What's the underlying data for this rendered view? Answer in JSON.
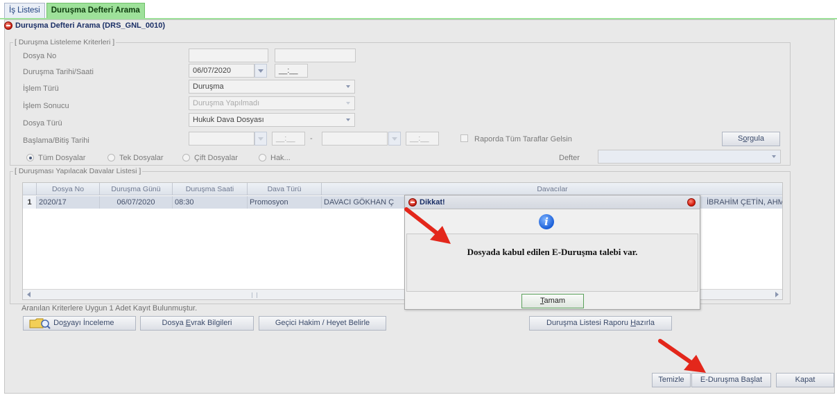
{
  "tabs": [
    {
      "label": "İş Listesi",
      "active": false
    },
    {
      "label": "Duruşma Defteri Arama",
      "active": true
    }
  ],
  "window_title": "Duruşma Defteri Arama (DRS_GNL_0010)",
  "criteria": {
    "legend": "[ Duruşma Listeleme Kriterleri ]",
    "dosya_no_label": "Dosya No",
    "durusma_tarihi_label": "Duruşma Tarihi/Saati",
    "durusma_tarihi_value": "06/07/2020",
    "durusma_saat_value": "__:__",
    "islem_turu_label": "İşlem Türü",
    "islem_turu_value": "Duruşma",
    "islem_sonucu_label": "İşlem Sonucu",
    "islem_sonucu_value": "Duruşma Yapılmadı",
    "dosya_turu_label": "Dosya Türü",
    "dosya_turu_value": "Hukuk Dava Dosyası",
    "baslama_label": "Başlama/Bitiş Tarihi",
    "baslama_saat": "__:__",
    "bitis_saat": "__:__",
    "dash": "-",
    "raporda_label": "Raporda Tüm Taraflar Gelsin",
    "sorgula_prefix": "S",
    "sorgula_underlined": "o",
    "sorgula_suffix": "rgula",
    "radios": [
      {
        "label": "Tüm Dosyalar",
        "selected": true
      },
      {
        "label": "Tek Dosyalar",
        "selected": false
      },
      {
        "label": "Çift Dosyalar",
        "selected": false
      },
      {
        "label": "Hak...",
        "selected": false
      }
    ],
    "defter_label": "Defter"
  },
  "list": {
    "legend": "[ Duruşması Yapılacak Davalar Listesi ]",
    "columns": [
      "Dosya No",
      "Duruşma Günü",
      "Duruşma Saati",
      "Dava Türü",
      "Davacılar"
    ],
    "rows": [
      {
        "index": "1",
        "dosya_no": "2020/17",
        "durusma_gunu": "06/07/2020",
        "durusma_saati": "08:30",
        "dava_turu": "Promosyon",
        "davacilar_left": "DAVACI GÖKHAN Ç",
        "davacilar_right": "İBRAHİM ÇETİN, AHM"
      }
    ]
  },
  "status_text": "Aranılan Kriterlere Uygun 1 Adet Kayıt Bulunmuştur.",
  "action_buttons": {
    "dosyayi_inceleme": {
      "pre": "Do",
      "u": "s",
      "post": "yayı İnceleme"
    },
    "dosya_evrak": {
      "pre": "Dosya ",
      "u": "E",
      "post": "vrak Bilgileri"
    },
    "gecici_hakim": "Geçici Hakim / Heyet Belirle",
    "durusma_raporu": {
      "pre": "Duruşma Listesi Raporu ",
      "u": "H",
      "post": "azırla"
    }
  },
  "bottom_buttons": {
    "temizle": "Temizle",
    "e_durusma": "E-Duruşma Başlat",
    "kapat": "Kapat"
  },
  "dialog": {
    "title": "Dikkat!",
    "icon": "info-icon",
    "message": "Dosyada kabul edilen E-Duruşma talebi var.",
    "ok_underlined": "T",
    "ok_rest": "amam"
  },
  "colors": {
    "active_tab": "#9ee19a",
    "arrow_red": "#e3271b",
    "selection_row": "#d7dde7"
  }
}
